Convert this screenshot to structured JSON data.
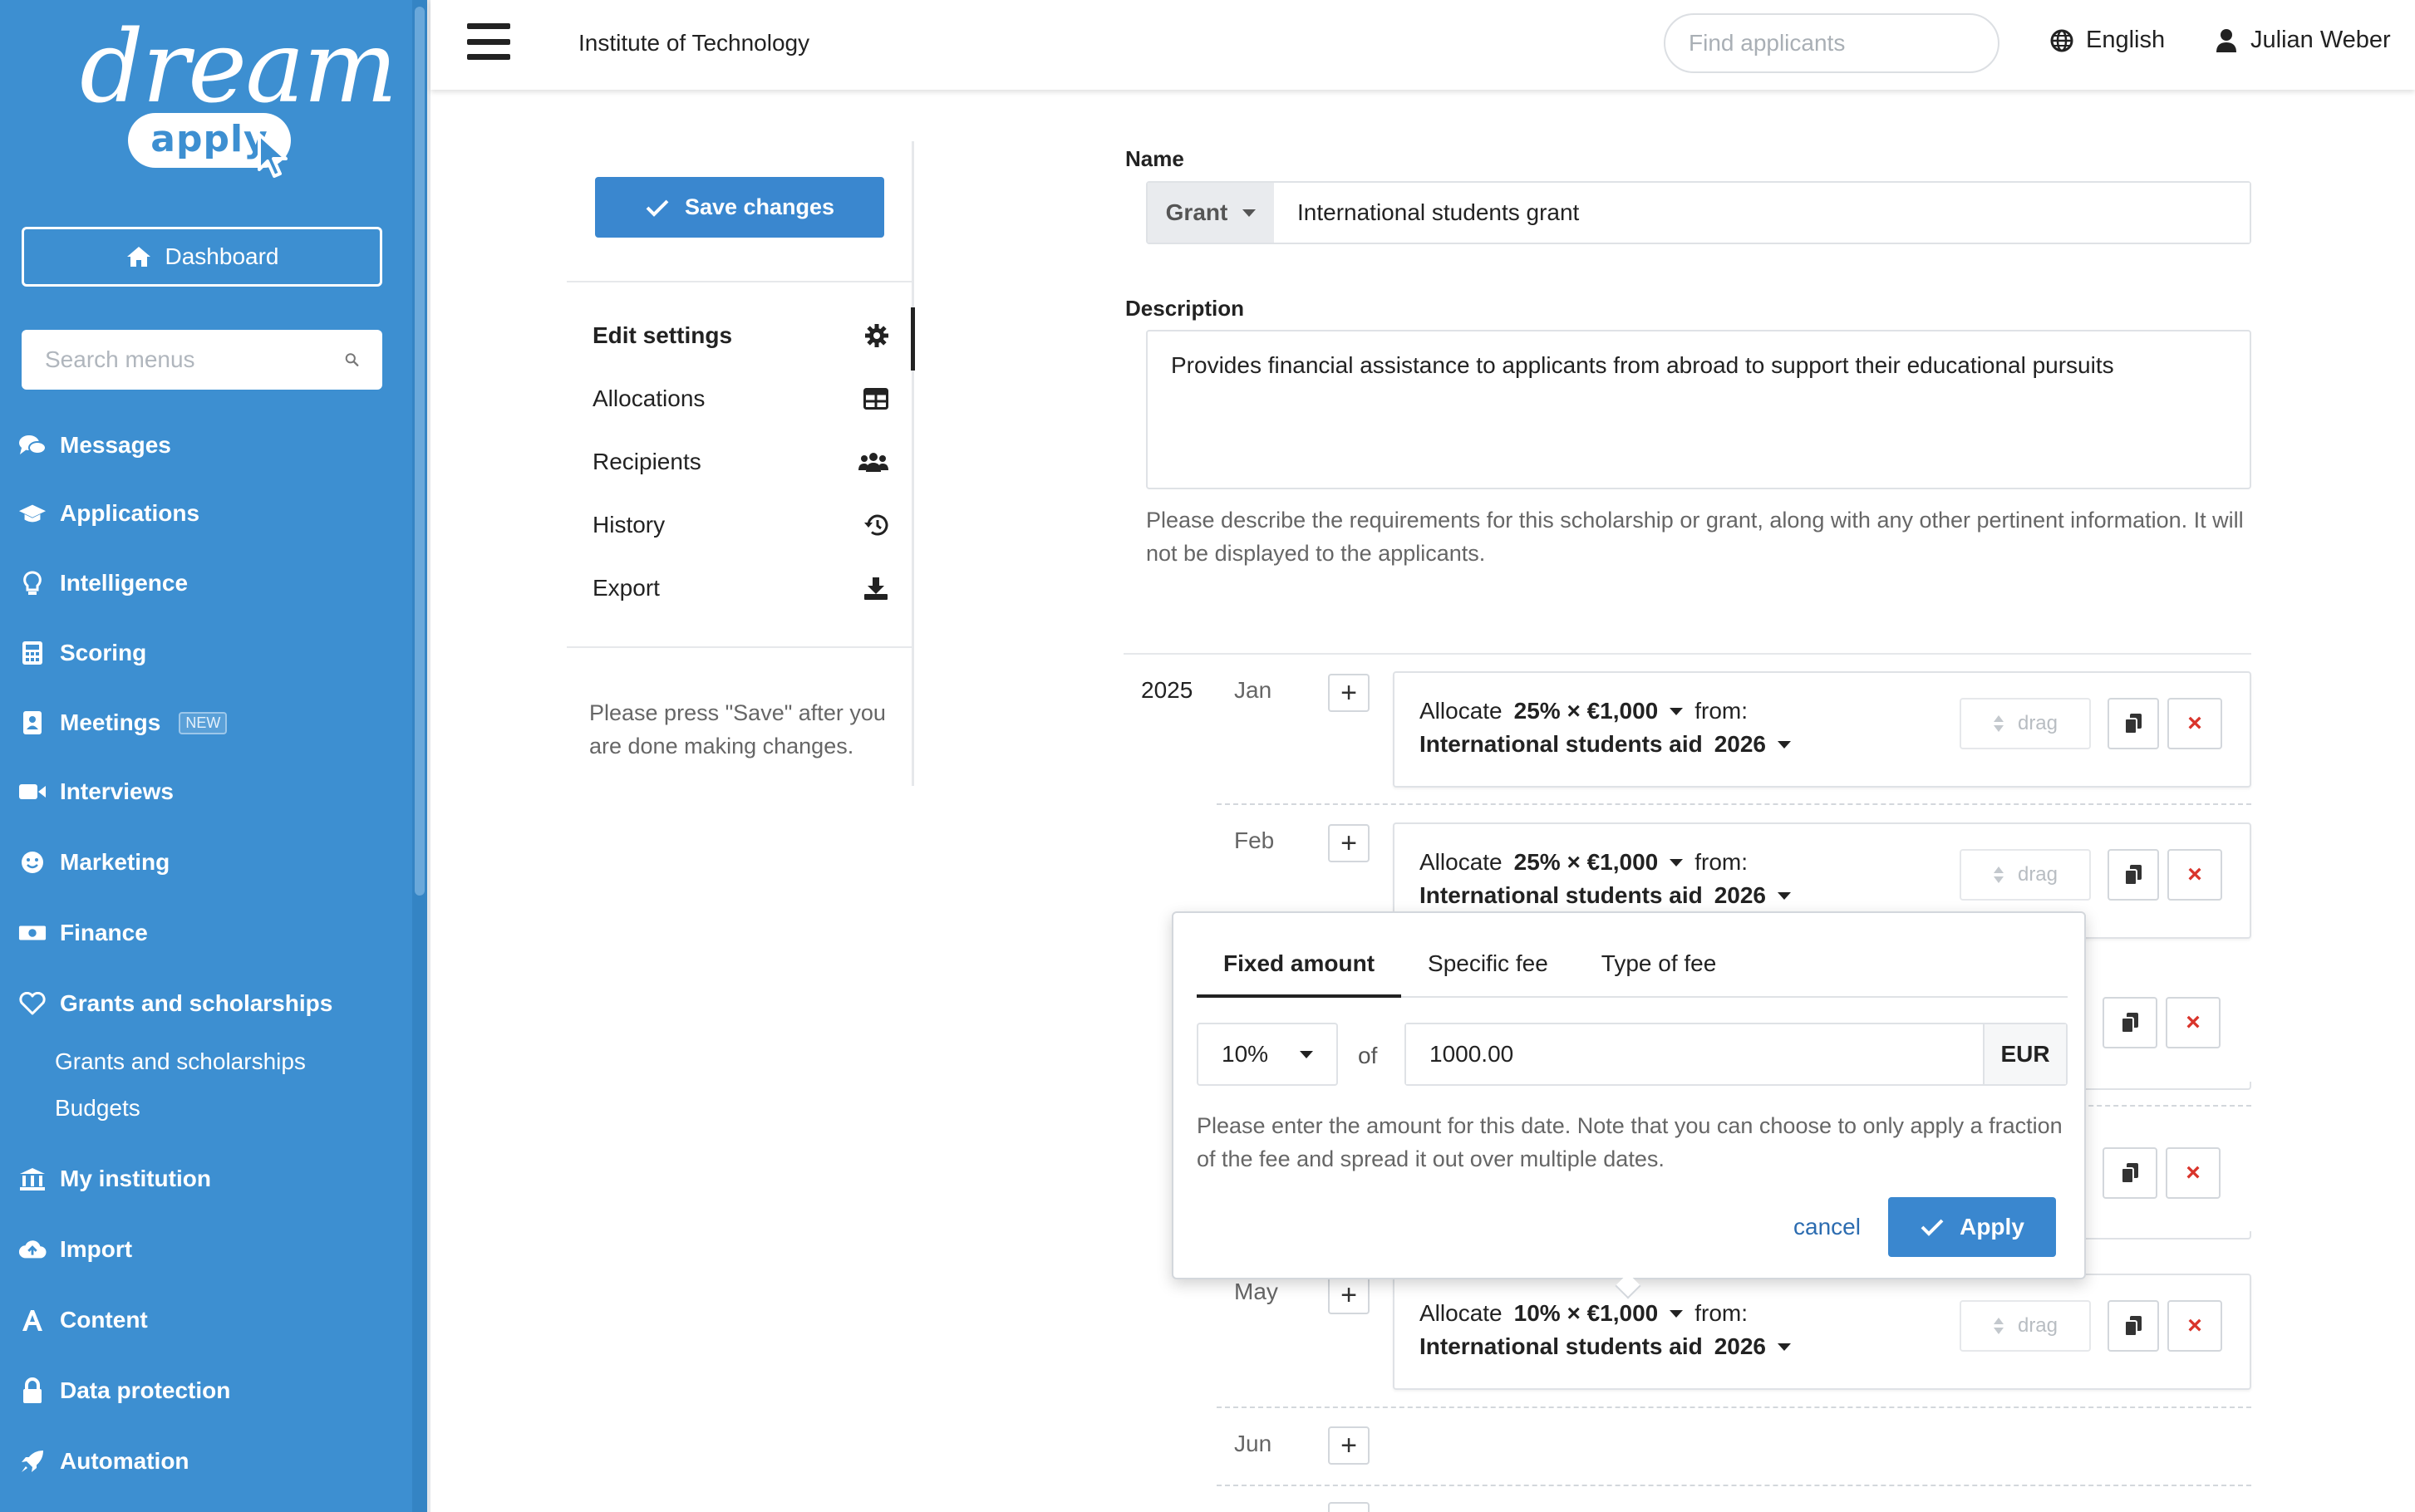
{
  "brand": {
    "word": "dream",
    "pill": "apply"
  },
  "sidebar": {
    "dashboard_label": "Dashboard",
    "search_placeholder": "Search menus",
    "items": [
      {
        "label": "Messages",
        "icon": "comments-icon"
      },
      {
        "label": "Applications",
        "icon": "graduation-cap-icon"
      },
      {
        "label": "Intelligence",
        "icon": "lightbulb-icon"
      },
      {
        "label": "Scoring",
        "icon": "calculator-icon"
      },
      {
        "label": "Meetings",
        "icon": "id-badge-icon",
        "badge": "NEW"
      },
      {
        "label": "Interviews",
        "icon": "video-camera-icon"
      },
      {
        "label": "Marketing",
        "icon": "smile-icon"
      },
      {
        "label": "Finance",
        "icon": "money-bill-icon"
      },
      {
        "label": "Grants and scholarships",
        "icon": "heart-icon"
      },
      {
        "label": "My institution",
        "icon": "university-icon"
      },
      {
        "label": "Import",
        "icon": "cloud-upload-icon"
      },
      {
        "label": "Content",
        "icon": "font-icon"
      },
      {
        "label": "Data protection",
        "icon": "lock-icon"
      },
      {
        "label": "Automation",
        "icon": "rocket-icon"
      }
    ],
    "subitems": [
      "Grants and scholarships",
      "Budgets"
    ]
  },
  "topbar": {
    "institution": "Institute of Technology",
    "search_placeholder": "Find applicants",
    "language": "English",
    "user": "Julian Weber"
  },
  "panel": {
    "save_label": "Save changes",
    "items": [
      {
        "label": "Edit settings",
        "icon": "cog-icon"
      },
      {
        "label": "Allocations",
        "icon": "table-icon"
      },
      {
        "label": "Recipients",
        "icon": "users-icon"
      },
      {
        "label": "History",
        "icon": "history-icon"
      },
      {
        "label": "Export",
        "icon": "download-icon"
      }
    ],
    "hint": "Please press \"Save\" after you are done making changes."
  },
  "form": {
    "name_label": "Name",
    "type_value": "Grant",
    "name_value": "International students grant",
    "description_label": "Description",
    "description_value": "Provides financial assistance to applicants from abroad to support their educational pursuits",
    "description_help": "Please describe the requirements for this scholarship or grant, along with any other pertinent information. It will not be displayed to the applicants."
  },
  "schedule": {
    "year": "2025",
    "months": [
      "Jan",
      "Feb",
      "May",
      "Jun"
    ],
    "allocations": [
      {
        "month": "Jan",
        "prefix": "Allocate",
        "amount": "25% × €1,000",
        "from": "from:",
        "source": "International students aid",
        "source_year": "2026"
      },
      {
        "month": "Feb",
        "prefix": "Allocate",
        "amount": "25% × €1,000",
        "from": "from:",
        "source": "International students aid",
        "source_year": "2026"
      },
      {
        "month": "May",
        "prefix": "Allocate",
        "amount": "10% × €1,000",
        "from": "from:",
        "source": "International students aid",
        "source_year": "2026"
      }
    ],
    "drag_label": "drag",
    "delete_glyph": "×",
    "add_glyph": "+"
  },
  "popover": {
    "tabs": [
      "Fixed amount",
      "Specific fee",
      "Type of fee"
    ],
    "percent": "10%",
    "of_label": "of",
    "amount": "1000.00",
    "currency": "EUR",
    "help": "Please enter the amount for this date. Note that you can choose to only apply a fraction of the fee and spread it out over multiple dates.",
    "cancel_label": "cancel",
    "apply_label": "Apply"
  },
  "colors": {
    "sidebar": "#3d8fd1",
    "primary_button": "#3a87cf",
    "delete": "#d9342b",
    "link": "#2c6cb0"
  }
}
